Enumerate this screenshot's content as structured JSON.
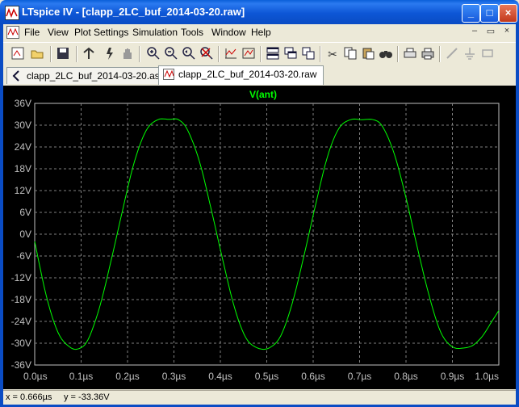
{
  "window": {
    "title": "LTspice IV - [clapp_2LC_buf_2014-03-20.raw]",
    "minimize_icon": "minimize-icon",
    "maximize_icon": "maximize-icon",
    "close_icon": "close-icon"
  },
  "menu": [
    "File",
    "View",
    "Plot Settings",
    "Simulation",
    "Tools",
    "Window",
    "Help"
  ],
  "mdi_controls": [
    "–",
    "▭",
    "×"
  ],
  "toolbar_icons": [
    "new-schematic-icon",
    "open-icon",
    "save-icon",
    "control-panel-icon",
    "run-icon",
    "halt-icon",
    "zoom-in-icon",
    "zoom-out-icon",
    "zoom-back-icon",
    "zoom-cancel-icon",
    "autorange-icon",
    "fit-icon",
    "tile-horizontal-icon",
    "cascade-icon",
    "tile-vertical-icon",
    "cut-icon",
    "copy-icon",
    "paste-icon",
    "find-icon",
    "print-setup-icon",
    "print-icon",
    "draw-line-icon",
    "ground-icon",
    "component-icon"
  ],
  "tabs": [
    {
      "label": "clapp_2LC_buf_2014-03-20.asc",
      "icon": "schematic-icon"
    },
    {
      "label": "clapp_2LC_buf_2014-03-20.raw",
      "icon": "waveform-icon"
    }
  ],
  "status": {
    "x": "x = 0.666µs",
    "y": "y = -33.36V"
  },
  "colors": {
    "trace": "#00ff00",
    "background": "#000000",
    "grid": "#808080",
    "axis_labels": "#c0c0c0"
  },
  "chart_data": {
    "type": "line",
    "title": "V(ant)",
    "x_ticks": [
      "0.0µs",
      "0.1µs",
      "0.2µs",
      "0.3µs",
      "0.4µs",
      "0.5µs",
      "0.6µs",
      "0.7µs",
      "0.8µs",
      "0.9µs",
      "1.0µs"
    ],
    "y_ticks": [
      "36V",
      "30V",
      "24V",
      "18V",
      "12V",
      "6V",
      "0V",
      "-6V",
      "-12V",
      "-18V",
      "-24V",
      "-30V",
      "-36V"
    ],
    "xlim": [
      0,
      1.0
    ],
    "ylim": [
      -36,
      36
    ],
    "x_unit": "µs",
    "y_unit": "V",
    "grid": true,
    "series": [
      {
        "name": "V(ant)",
        "x": [
          0.0,
          0.025,
          0.05,
          0.075,
          0.095,
          0.115,
          0.14,
          0.165,
          0.19,
          0.215,
          0.24,
          0.265,
          0.29,
          0.31,
          0.33,
          0.355,
          0.38,
          0.405,
          0.43,
          0.455,
          0.48,
          0.505,
          0.53,
          0.555,
          0.58,
          0.605,
          0.63,
          0.655,
          0.68,
          0.705,
          0.73,
          0.75,
          0.775,
          0.8,
          0.825,
          0.85,
          0.875,
          0.9,
          0.925,
          0.945,
          0.965,
          0.985,
          1.0
        ],
        "y": [
          -2,
          -17,
          -27,
          -31,
          -31.5,
          -29,
          -20,
          -7,
          7,
          20,
          28.5,
          31.5,
          31.6,
          31.5,
          28.5,
          20,
          7,
          -7,
          -20,
          -28.5,
          -31.3,
          -31.3,
          -28,
          -19,
          -6,
          8,
          21,
          29,
          31.5,
          31.5,
          31.5,
          29.5,
          22,
          10,
          -4,
          -17,
          -27,
          -31,
          -31.3,
          -30.5,
          -28,
          -24,
          -21
        ]
      }
    ]
  }
}
